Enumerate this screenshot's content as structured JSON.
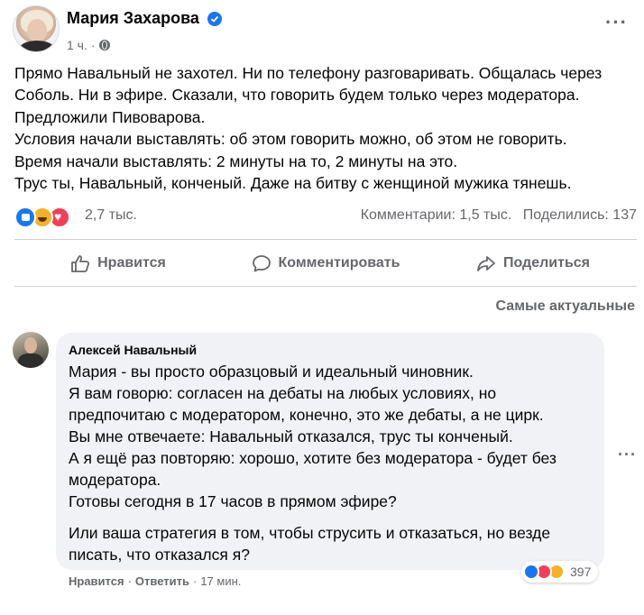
{
  "post": {
    "author": "Мария Захарова",
    "time": "1 ч.",
    "separator": "·",
    "lines": [
      "Прямо Навальный не захотел. Ни по телефону разговаривать. Общалась через",
      "Соболь.  Ни в эфире. Сказали, что говорить  будем только через модератора.",
      "Предложили Пивоварова.",
      "Условия начали выставлять: об этом говорить можно, об этом не говорить.",
      "Время начали выставлять: 2 минуты на то, 2 минуты на это.",
      "Трус ты, Навальный,  конченый. Даже на битву с женщиной мужика тянешь."
    ],
    "reactions_count": "2,7 тыс.",
    "comments_stat": "Комментарии: 1,5 тыс.",
    "shares_stat": "Поделились: 137"
  },
  "actions": {
    "like": "Нравится",
    "comment": "Комментировать",
    "share": "Поделиться"
  },
  "sort_label": "Самые актуальные",
  "comment": {
    "author": "Алексей Навальный",
    "lines_a": [
      "Мария - вы просто образцовый и идеальный чиновник.",
      "Я вам говорю: согласен на дебаты на любых условиях, но",
      "предпочитаю с модератором, конечно, это же дебаты, а не цирк.",
      "Вы мне отвечаете: Навальный отказался, трус ты конченый.",
      "А я ещё раз повторяю: хорошо, хотите без модератора - будет без",
      "модератора.",
      "Готовы сегодня в 17 часов в прямом эфире?"
    ],
    "lines_b": [
      "Или ваша стратегия в том, чтобы струсить и отказаться, но везде",
      "писать, что отказался я?"
    ],
    "like_action": "Нравится",
    "reply_action": "Ответить",
    "dot": "·",
    "time": "17 мин.",
    "reactions_count": "397"
  },
  "colors": {
    "accent": "#1877f2",
    "secondary_text": "#65676b",
    "bubble": "#f0f2f5",
    "love": "#f33e58",
    "haha": "#f7b125"
  },
  "icons": [
    "verified-icon",
    "globe-icon",
    "more-icon",
    "like-icon",
    "comment-icon",
    "share-icon"
  ]
}
